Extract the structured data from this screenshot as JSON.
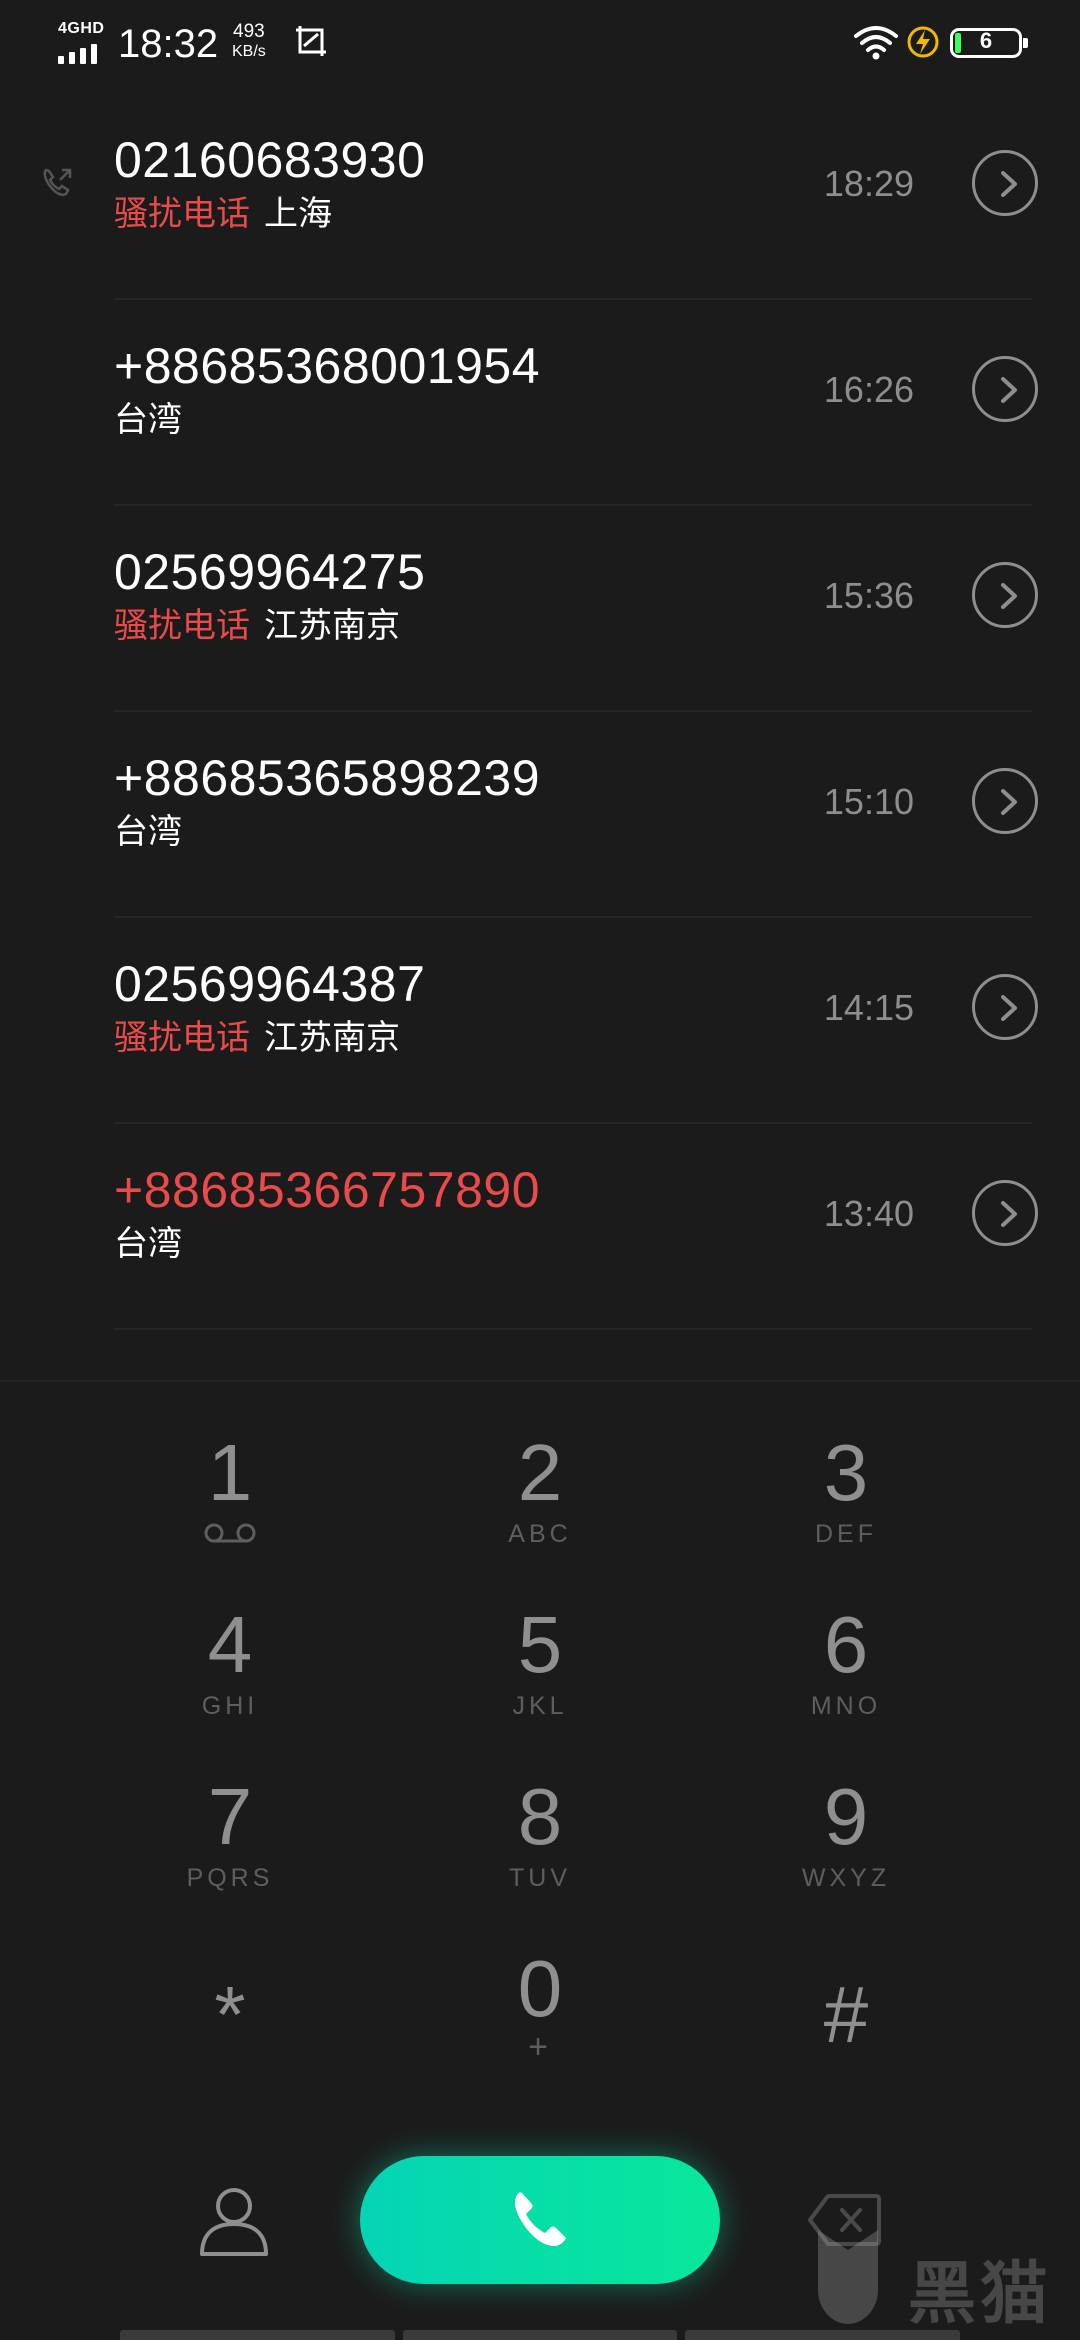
{
  "status_bar": {
    "network": "4GHD",
    "time": "18:32",
    "speed_value": "493",
    "speed_unit": "KB/s",
    "battery_level": "6",
    "icons": [
      "signal-icon",
      "screenshot-icon",
      "wifi-icon",
      "charging-icon",
      "battery-icon"
    ]
  },
  "calls": [
    {
      "number": "02160683930",
      "tag": "骚扰电话",
      "location": "上海",
      "time": "18:29",
      "missed": false
    },
    {
      "number": "+88685368001954",
      "tag": "",
      "location": "台湾",
      "time": "16:26",
      "missed": false
    },
    {
      "number": "02569964275",
      "tag": "骚扰电话",
      "location": "江苏南京",
      "time": "15:36",
      "missed": false
    },
    {
      "number": "+88685365898239",
      "tag": "",
      "location": "台湾",
      "time": "15:10",
      "missed": false
    },
    {
      "number": "02569964387",
      "tag": "骚扰电话",
      "location": "江苏南京",
      "time": "14:15",
      "missed": false
    },
    {
      "number": "+88685366757890",
      "tag": "",
      "location": "台湾",
      "time": "13:40",
      "missed": true
    }
  ],
  "keypad": {
    "keys": [
      {
        "digit": "1",
        "letters": ""
      },
      {
        "digit": "2",
        "letters": "ABC"
      },
      {
        "digit": "3",
        "letters": "DEF"
      },
      {
        "digit": "4",
        "letters": "GHI"
      },
      {
        "digit": "5",
        "letters": "JKL"
      },
      {
        "digit": "6",
        "letters": "MNO"
      },
      {
        "digit": "7",
        "letters": "PQRS"
      },
      {
        "digit": "8",
        "letters": "TUV"
      },
      {
        "digit": "9",
        "letters": "WXYZ"
      },
      {
        "digit": "*",
        "letters": ""
      },
      {
        "digit": "0",
        "letters": "+"
      },
      {
        "digit": "#",
        "letters": ""
      }
    ]
  },
  "colors": {
    "background": "#1b1b1b",
    "spam_tag": "#e94a4a",
    "missed_call": "#e94a4a",
    "call_button_start": "#05d4b5",
    "call_button_end": "#08e89a"
  },
  "watermark": {
    "text": "黑猫"
  }
}
